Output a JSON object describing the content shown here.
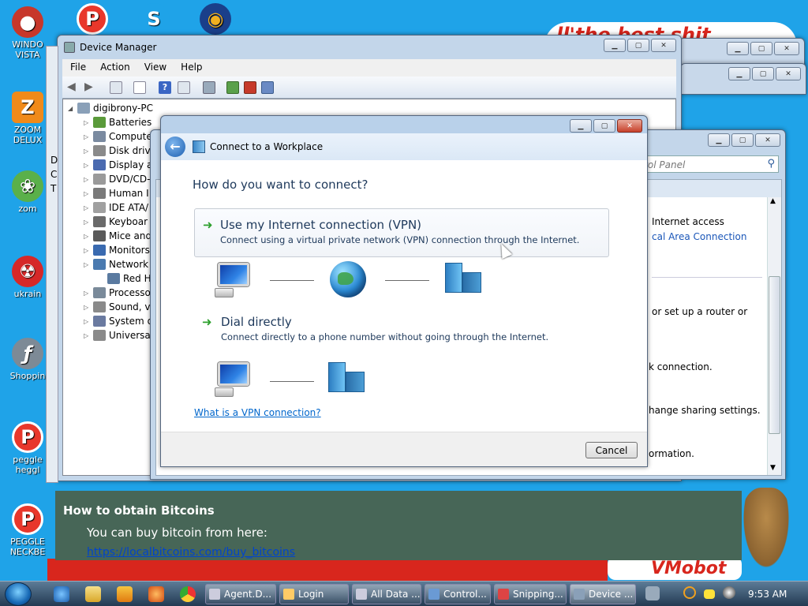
{
  "desktop": {
    "icons": [
      {
        "label": "WINDO\nVISTA",
        "glyph": "●"
      },
      {
        "label": "ZOOM\nDELUX",
        "glyph": "Z"
      },
      {
        "label": "zom",
        "glyph": "❀"
      },
      {
        "label": "ukrain",
        "glyph": "☢"
      },
      {
        "label": "Shoppin",
        "glyph": "ƒ"
      },
      {
        "label": "peggle\nheggl",
        "glyph": "P"
      },
      {
        "label": "PEGGLE\nNECKBE",
        "glyph": "P"
      }
    ],
    "top_icons": [
      {
        "glyph": "P"
      },
      {
        "glyph": "S"
      },
      {
        "glyph": "◉"
      }
    ],
    "wallpaper_text_top": "ll'the best shit",
    "wallpaper_text_bottom": "VMobot"
  },
  "device_manager": {
    "title": "Device Manager",
    "menu": [
      "File",
      "Action",
      "View",
      "Help"
    ],
    "root": "digibrony-PC",
    "tree": [
      "Batteries",
      "Compute",
      "Disk drive",
      "Display a",
      "DVD/CD-",
      "Human I",
      "IDE ATA/",
      "Keyboar",
      "Mice and",
      "Monitors",
      "Network",
      "Red H",
      "Processo",
      "Sound, v",
      "System d",
      "Universal"
    ],
    "side_letters": [
      "D",
      "C",
      "T"
    ]
  },
  "control_panel": {
    "search_placeholder": "rol Panel",
    "lines": [
      "Internet access",
      "cal Area Connection",
      "or set up a router or",
      "k connection.",
      "hange sharing settings.",
      "ormation."
    ]
  },
  "dialog": {
    "title": "Connect to a Workplace",
    "heading": "How do you want to connect?",
    "option1_title": "Use my Internet connection (VPN)",
    "option1_desc": "Connect using a virtual private network (VPN) connection through the Internet.",
    "option2_title": "Dial directly",
    "option2_desc": "Connect directly to a phone number without going through the Internet.",
    "help_link": "What is a VPN connection?",
    "cancel_label": "Cancel"
  },
  "bitcoin_banner": {
    "title": "How to obtain Bitcoins",
    "subtitle": "You can buy bitcoin from here:",
    "link": "https://localbitcoins.com/buy_bitcoins"
  },
  "taskbar": {
    "tasks": [
      "Agent.D...",
      "Login",
      "All Data ...",
      "Control...",
      "Snipping...",
      "Device ..."
    ],
    "clock": "9:53 AM"
  },
  "colors": {
    "desktop_bg": "#1fa3e8",
    "dialog_heading": "#1e395b",
    "link": "#0066cc",
    "banner_bg": "#476657"
  }
}
